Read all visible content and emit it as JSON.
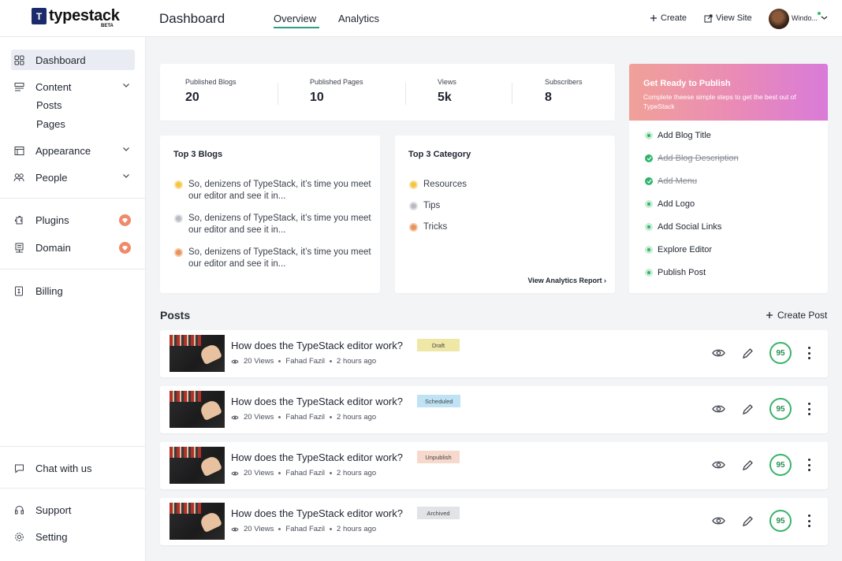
{
  "brand": {
    "name": "typestack",
    "mark": "T",
    "beta": "BETA"
  },
  "header": {
    "page_title": "Dashboard",
    "tabs": [
      {
        "label": "Overview",
        "active": true
      },
      {
        "label": "Analytics",
        "active": false
      }
    ],
    "create_label": "Create",
    "view_site_label": "View Site",
    "user_name": "Windo..."
  },
  "sidebar": {
    "dashboard": "Dashboard",
    "content": "Content",
    "posts": "Posts",
    "pages": "Pages",
    "appearance": "Appearance",
    "people": "People",
    "plugins": "Plugins",
    "domain": "Domain",
    "billing": "Billing",
    "chat": "Chat with us",
    "support": "Support",
    "setting": "Setting"
  },
  "stats": [
    {
      "label": "Published Blogs",
      "value": "20"
    },
    {
      "label": "Published Pages",
      "value": "10"
    },
    {
      "label": "Views",
      "value": "5k"
    },
    {
      "label": "Subscribers",
      "value": "8"
    }
  ],
  "top_blogs": {
    "title": "Top 3 Blogs",
    "items": [
      "So, denizens of TypeStack, it’s time you meet our editor and see it in...",
      "So, denizens of TypeStack, it’s time you meet our editor and see it in...",
      "So, denizens of TypeStack, it’s time you meet our editor and see it in..."
    ]
  },
  "top_category": {
    "title": "Top 3 Category",
    "items": [
      "Resources",
      "Tips",
      "Tricks"
    ],
    "report_link": "View Analytics Report"
  },
  "publish": {
    "title": "Get Ready to Publish",
    "subtitle": "Complete theese simple steps to get the best out of TypeStack",
    "steps": [
      {
        "label": "Add Blog Title",
        "done": false
      },
      {
        "label": "Add Blog Description",
        "done": true
      },
      {
        "label": "Add Menu",
        "done": true
      },
      {
        "label": "Add Logo",
        "done": false
      },
      {
        "label": "Add Social Links",
        "done": false
      },
      {
        "label": "Explore Editor",
        "done": false
      },
      {
        "label": "Publish Post",
        "done": false
      }
    ]
  },
  "posts": {
    "title": "Posts",
    "create_label": "Create Post",
    "items": [
      {
        "title": "How does the TypeStack editor work?",
        "status": "Draft",
        "views": "20 Views",
        "author": "Fahad Fazil",
        "time": "2 hours ago",
        "score": "95"
      },
      {
        "title": "How does the TypeStack editor work?",
        "status": "Scheduled",
        "views": "20 Views",
        "author": "Fahad Fazil",
        "time": "2 hours ago",
        "score": "95"
      },
      {
        "title": "How does the TypeStack editor work?",
        "status": "Unpublish",
        "views": "20 Views",
        "author": "Fahad Fazil",
        "time": "2 hours ago",
        "score": "95"
      },
      {
        "title": "How does the TypeStack editor work?",
        "status": "Archived",
        "views": "20 Views",
        "author": "Fahad Fazil",
        "time": "2 hours ago",
        "score": "95"
      }
    ]
  },
  "colors": {
    "accent": "#2e9e88",
    "draft": "#efe7a6",
    "scheduled": "#bfe3f5",
    "unpublish": "#f7d8cc",
    "archived": "#e2e3e6",
    "score": "#39b36a"
  }
}
